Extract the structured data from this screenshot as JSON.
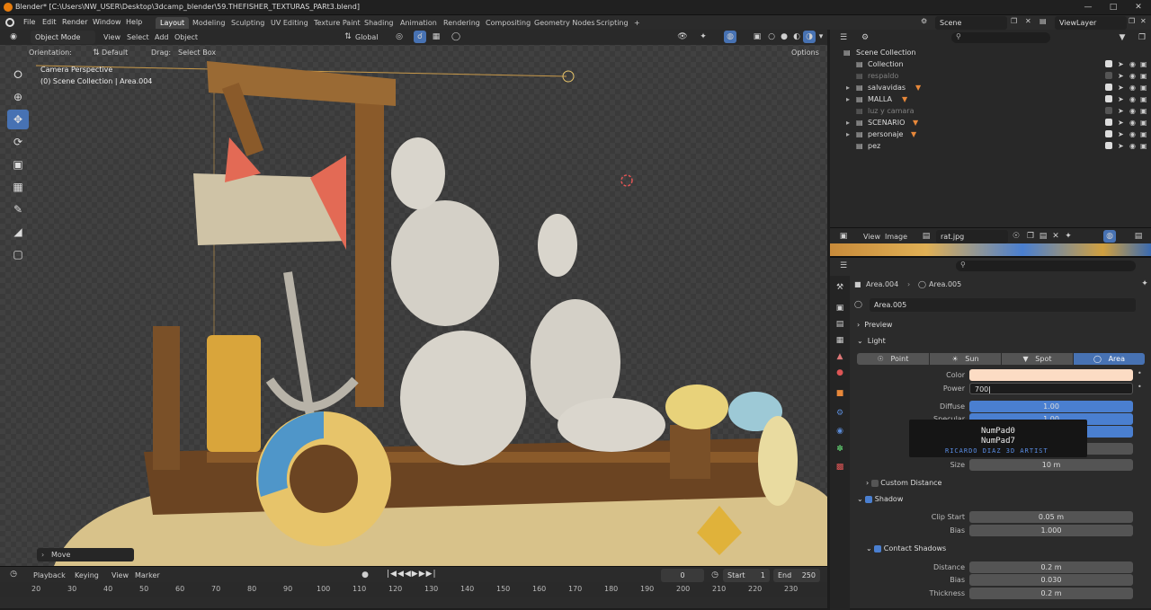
{
  "window": {
    "title": "Blender* [C:\\Users\\NW_USER\\Desktop\\3dcamp_blender\\59.THEFISHER_TEXTURAS_PARt3.blend]"
  },
  "menus": [
    "File",
    "Edit",
    "Render",
    "Window",
    "Help"
  ],
  "workspaces": [
    "Layout",
    "Modeling",
    "Sculpting",
    "UV Editing",
    "Texture Paint",
    "Shading",
    "Animation",
    "Rendering",
    "Compositing",
    "Geometry Nodes",
    "Scripting"
  ],
  "workspace_add": "+",
  "scene": {
    "label": "Scene",
    "view_layer": "ViewLayer"
  },
  "viewport": {
    "mode": "Object Mode",
    "menus": [
      "View",
      "Select",
      "Add",
      "Object"
    ],
    "transform": "Global",
    "orientation_label": "Orientation:",
    "orientation_value": "Default",
    "drag_label": "Drag:",
    "drag_value": "Select Box",
    "options": "Options",
    "perspective": "Camera Perspective",
    "collection_info": "(0) Scene Collection | Area.004",
    "operator": "Move"
  },
  "timeline": {
    "menus": [
      "Playback",
      "Keying",
      "View",
      "Marker"
    ],
    "current_frame": "0",
    "start_label": "Start",
    "start": "1",
    "end_label": "End",
    "end": "250",
    "ticks": [
      "20",
      "30",
      "40",
      "50",
      "60",
      "70",
      "80",
      "90",
      "100",
      "110",
      "120",
      "130",
      "140",
      "150",
      "160",
      "170",
      "180",
      "190",
      "200",
      "210",
      "220",
      "230"
    ]
  },
  "outliner": {
    "rows": [
      {
        "label": "Scene Collection",
        "dim": false
      },
      {
        "label": "Collection",
        "dim": false
      },
      {
        "label": "respaldo",
        "dim": true
      },
      {
        "label": "salvavidas",
        "dim": false
      },
      {
        "label": "MALLA",
        "dim": false
      },
      {
        "label": "luz y camara",
        "dim": true
      },
      {
        "label": "SCENARIO",
        "dim": false
      },
      {
        "label": "personaje",
        "dim": false
      },
      {
        "label": "pez",
        "dim": false
      }
    ]
  },
  "image_editor": {
    "menus": [
      "View",
      "Image"
    ],
    "image": "rat.jpg"
  },
  "properties": {
    "breadcrumb_object": "Area.004",
    "breadcrumb_data": "Area.005",
    "datablock": "Area.005",
    "preview": "Preview",
    "light": "Light",
    "light_types": [
      "Point",
      "Sun",
      "Spot",
      "Area"
    ],
    "color_label": "Color",
    "color": "#fcdcc4",
    "power_label": "Power",
    "power": "700",
    "diffuse_label": "Diffuse",
    "diffuse": "1.00",
    "specular_label": "Specular",
    "specular": "1.00",
    "size_label": "Size",
    "size": "10 m",
    "custom_distance": "Custom Distance",
    "shadow": "Shadow",
    "clip_start_label": "Clip Start",
    "clip_start": "0.05 m",
    "bias_label": "Bias",
    "bias": "1.000",
    "contact_shadows": "Contact Shadows",
    "distance_label": "Distance",
    "distance": "0.2 m",
    "bias2_label": "Bias",
    "bias2": "0.030",
    "thickness_label": "Thickness",
    "thickness": "0.2 m"
  },
  "key_overlay": {
    "line1": "NumPad0",
    "line2": "NumPad7",
    "credit": "RICARDO DIAZ 3D ARTIST"
  },
  "colors": {
    "accent": "#4772b3",
    "light_blue": "#4a7fd0",
    "orange": "#e8883a"
  }
}
